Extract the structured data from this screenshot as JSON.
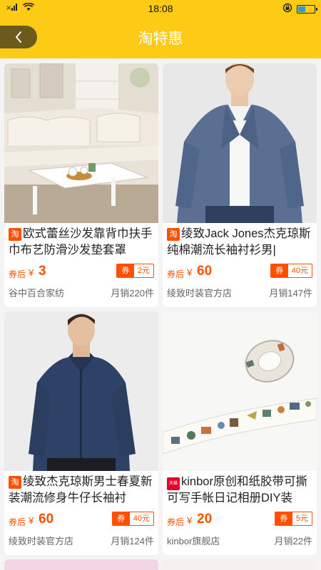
{
  "status_bar": {
    "signal": "×∥",
    "time": "18:08"
  },
  "header": {
    "title": "淘特惠",
    "accent": "#FDCB16"
  },
  "products": [
    {
      "platform": "taobao",
      "badge_text": "淘",
      "name": "欧式蕾丝沙发靠背巾扶手巾布艺防滑沙发垫套罩",
      "price_prefix": "券后",
      "currency": "¥",
      "price": "3",
      "coupon_label": "券",
      "coupon_value": "2元",
      "shop": "谷中百合家纺",
      "sales": "月销220件"
    },
    {
      "platform": "taobao",
      "badge_text": "淘",
      "name": "绫致Jack Jones杰克琼斯纯棉潮流长袖衬衫男|",
      "price_prefix": "券后",
      "currency": "¥",
      "price": "60",
      "coupon_label": "券",
      "coupon_value": "40元",
      "shop": "绫致时装官方店",
      "sales": "月销147件"
    },
    {
      "platform": "taobao",
      "badge_text": "淘",
      "name": "绫致杰克琼斯男士春夏新装潮流修身牛仔长袖衬",
      "price_prefix": "券后",
      "currency": "¥",
      "price": "60",
      "coupon_label": "券",
      "coupon_value": "40元",
      "shop": "绫致时装官方店",
      "sales": "月销124件"
    },
    {
      "platform": "tmall",
      "badge_text": "天猫",
      "name": "kinbor原创和纸胶带可撕可写手帐日记相册DIY装",
      "price_prefix": "券后",
      "currency": "¥",
      "price": "20",
      "coupon_label": "券",
      "coupon_value": "5元",
      "shop": "kinbor旗舰店",
      "sales": "月销22件"
    }
  ]
}
